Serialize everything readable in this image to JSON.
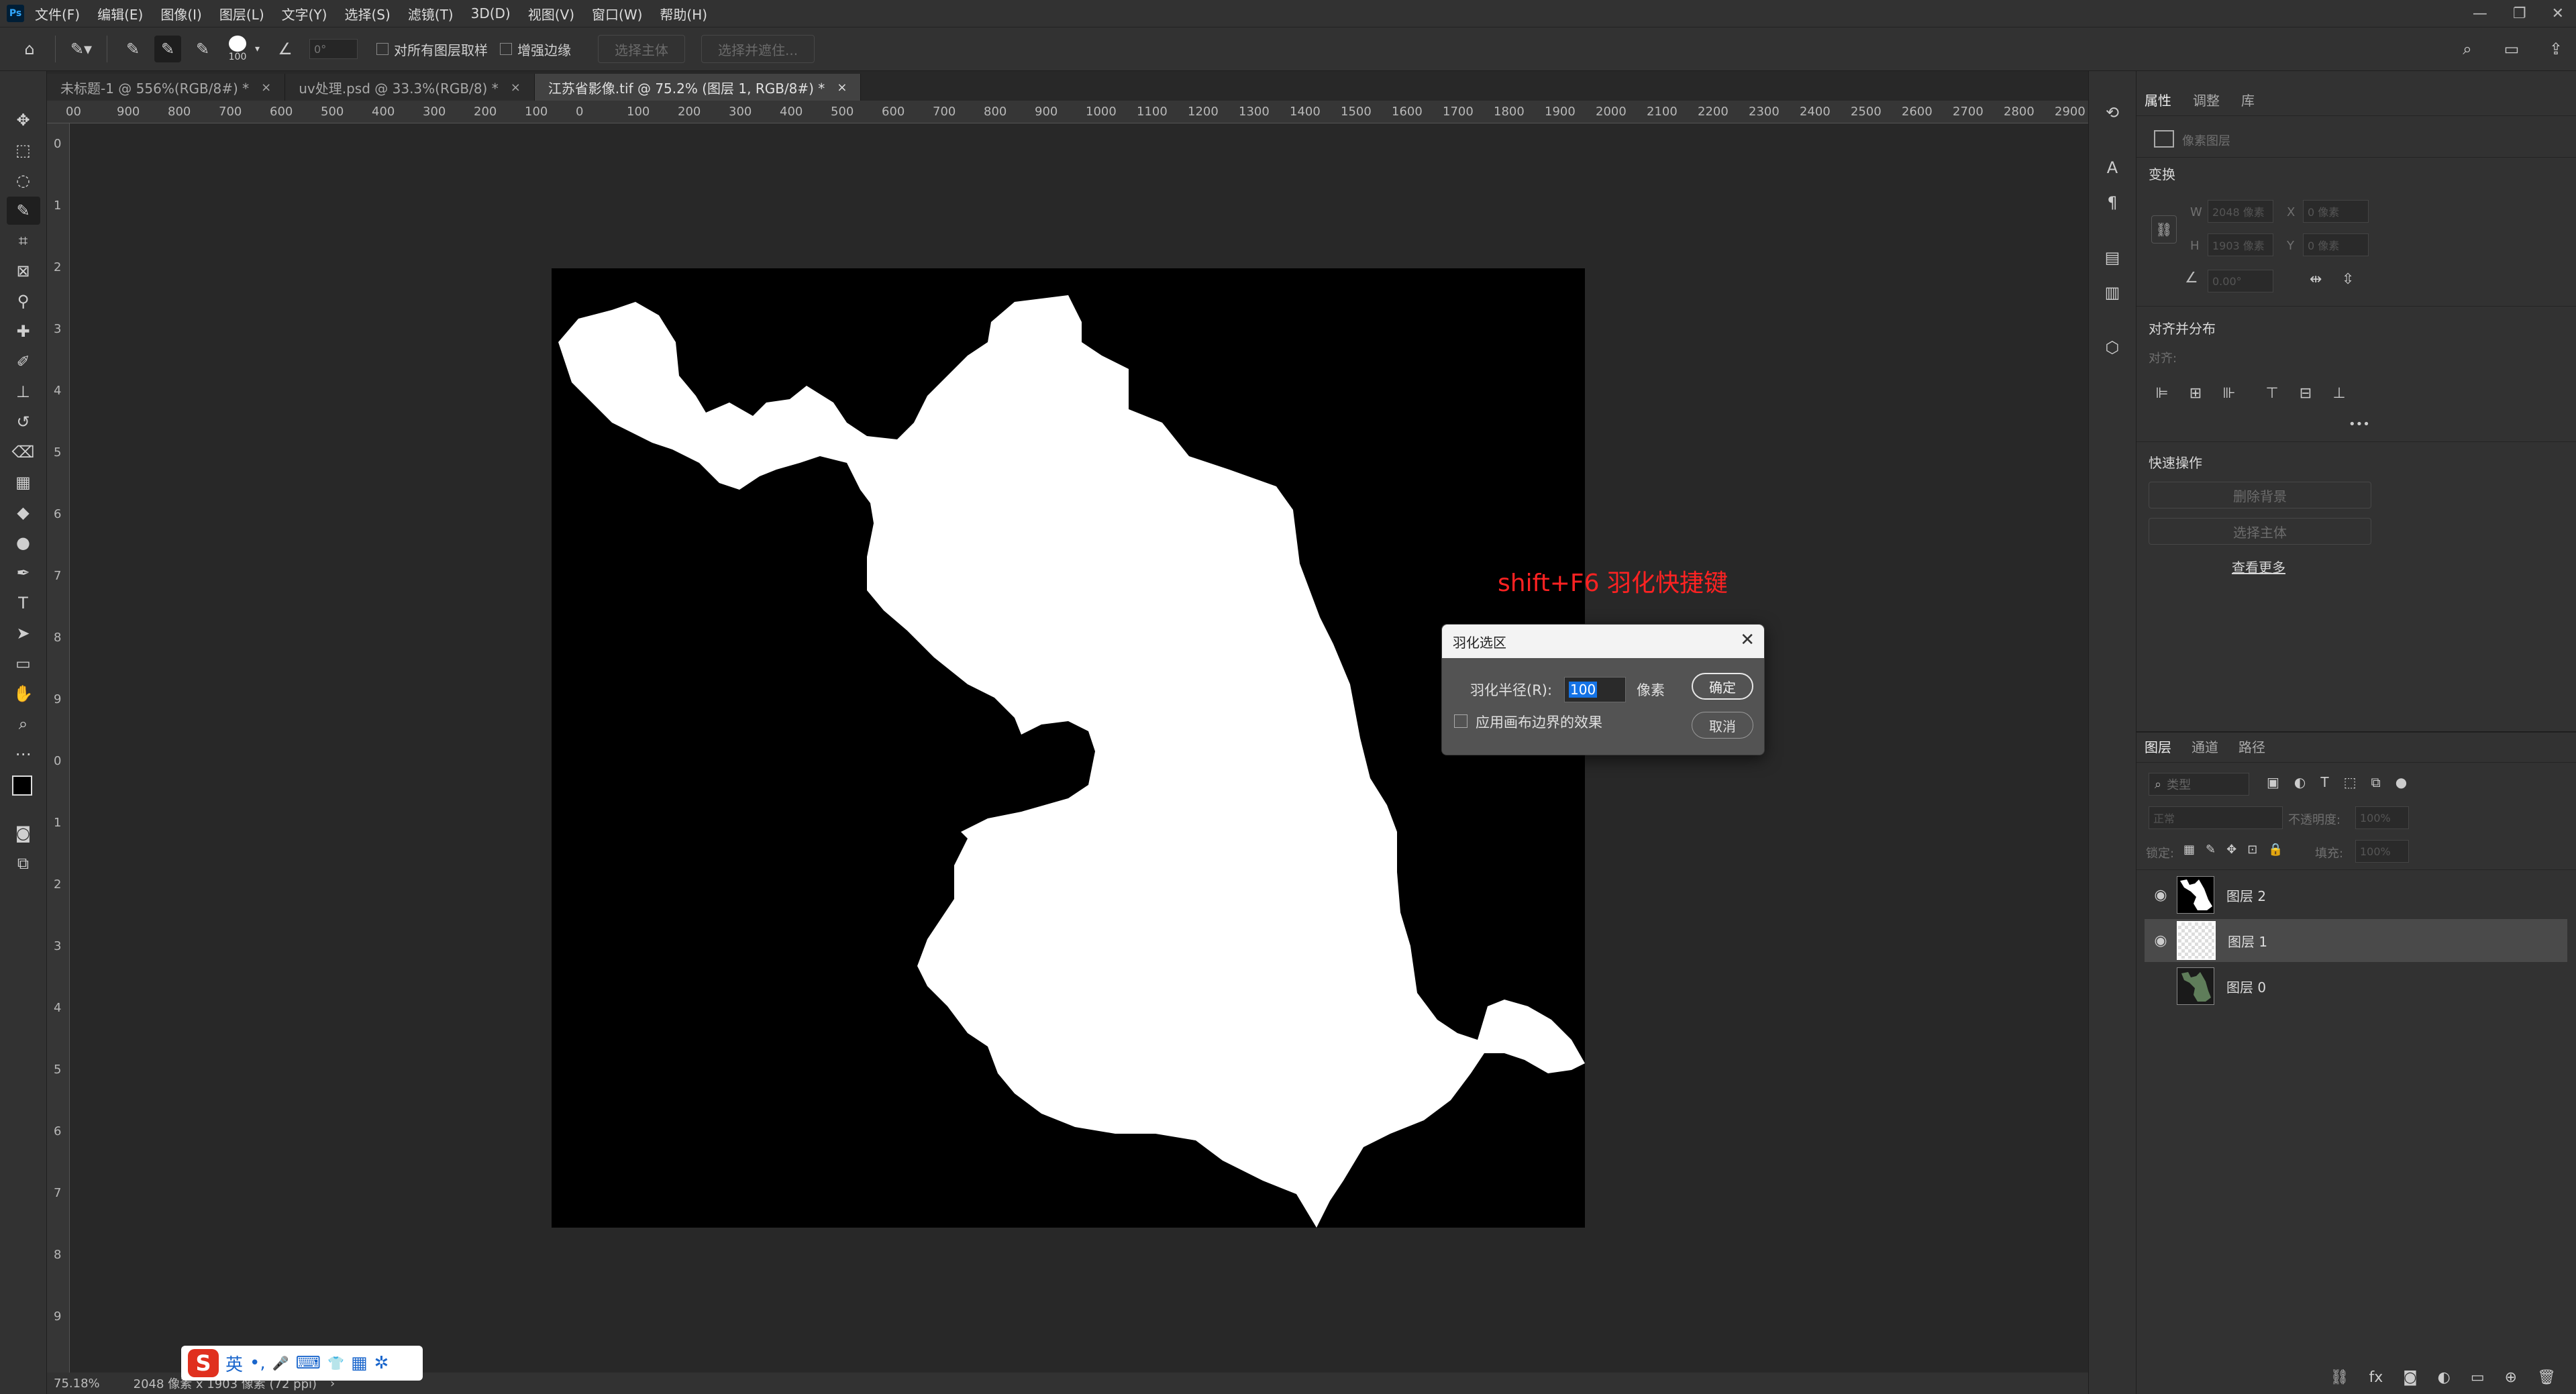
{
  "app": {
    "logo": "Ps"
  },
  "menu": [
    "文件(F)",
    "编辑(E)",
    "图像(I)",
    "图层(L)",
    "文字(Y)",
    "选择(S)",
    "滤镜(T)",
    "3D(D)",
    "视图(V)",
    "窗口(W)",
    "帮助(H)"
  ],
  "window_controls": {
    "minimize": "—",
    "restore": "❐",
    "close": "✕"
  },
  "options": {
    "brush_size": "100",
    "angle_value": "0°",
    "sample_all_layers": "对所有图层取样",
    "enhance_edge": "增强边缘",
    "select_subject": "选择主体",
    "select_and_mask": "选择并遮住..."
  },
  "tabs": [
    {
      "label": "未标题-1 @ 556%(RGB/8#) *",
      "close": "×"
    },
    {
      "label": "uv处理.psd @ 33.3%(RGB/8) *",
      "close": "×"
    },
    {
      "label": "江苏省影像.tif @ 75.2% (图层 1, RGB/8#) *",
      "close": "×"
    }
  ],
  "ruler_h_labels": [
    "00",
    "900",
    "800",
    "700",
    "600",
    "500",
    "400",
    "300",
    "200",
    "100",
    "0",
    "100",
    "200",
    "300",
    "400",
    "500",
    "600",
    "700",
    "800",
    "900",
    "1000",
    "1100",
    "1200",
    "1300",
    "1400",
    "1500",
    "1600",
    "1700",
    "1800",
    "1900",
    "2000",
    "2100",
    "2200",
    "2300",
    "2400",
    "2500",
    "2600",
    "2700",
    "2800",
    "2900"
  ],
  "ruler_v_labels": [
    "0",
    "1",
    "2",
    "3",
    "4",
    "5",
    "6",
    "7",
    "8",
    "9",
    "0",
    "1",
    "2",
    "3",
    "4",
    "5",
    "6",
    "7",
    "8",
    "9"
  ],
  "annotation": "shift+F6 羽化快捷键",
  "dialog": {
    "title": "羽化选区",
    "close": "✕",
    "radius_label": "羽化半径(R):",
    "radius_value": "100",
    "unit": "像素",
    "ok": "确定",
    "cancel": "取消",
    "apply_canvas_label": "应用画布边界的效果"
  },
  "status": {
    "zoom": "75.18%",
    "doc_info": "2048 像素 x 1903 像素 (72 ppi)",
    "arrow": "›"
  },
  "ime": {
    "logo": "S",
    "mode": "英",
    "items": [
      "•,",
      "🎤",
      "⌨",
      "👕",
      "▦",
      "✲"
    ]
  },
  "properties": {
    "tabs": [
      "属性",
      "调整",
      "库"
    ],
    "type": "像素图层",
    "transform_title": "变换",
    "w_label": "W",
    "w_value": "2048 像素",
    "x_label": "X",
    "x_value": "0 像素",
    "h_label": "H",
    "h_value": "1903 像素",
    "y_label": "Y",
    "y_value": "0 像素",
    "angle_value": "0.00°",
    "align_title": "对齐并分布",
    "align_label": "对齐:",
    "more": "•••",
    "quick_title": "快速操作",
    "remove_bg": "删除背景",
    "select_subject": "选择主体",
    "see_more": "查看更多"
  },
  "layers": {
    "tabs": [
      "图层",
      "通道",
      "路径"
    ],
    "filter_label": "类型",
    "blend_mode": "正常",
    "opacity_label": "不透明度:",
    "opacity_value": "100%",
    "lock_label": "锁定:",
    "fill_label": "填充:",
    "fill_value": "100%",
    "items": [
      {
        "name": "图层 2",
        "visible": true
      },
      {
        "name": "图层 1",
        "visible": true,
        "selected": true
      },
      {
        "name": "图层 0",
        "visible": false
      }
    ]
  }
}
